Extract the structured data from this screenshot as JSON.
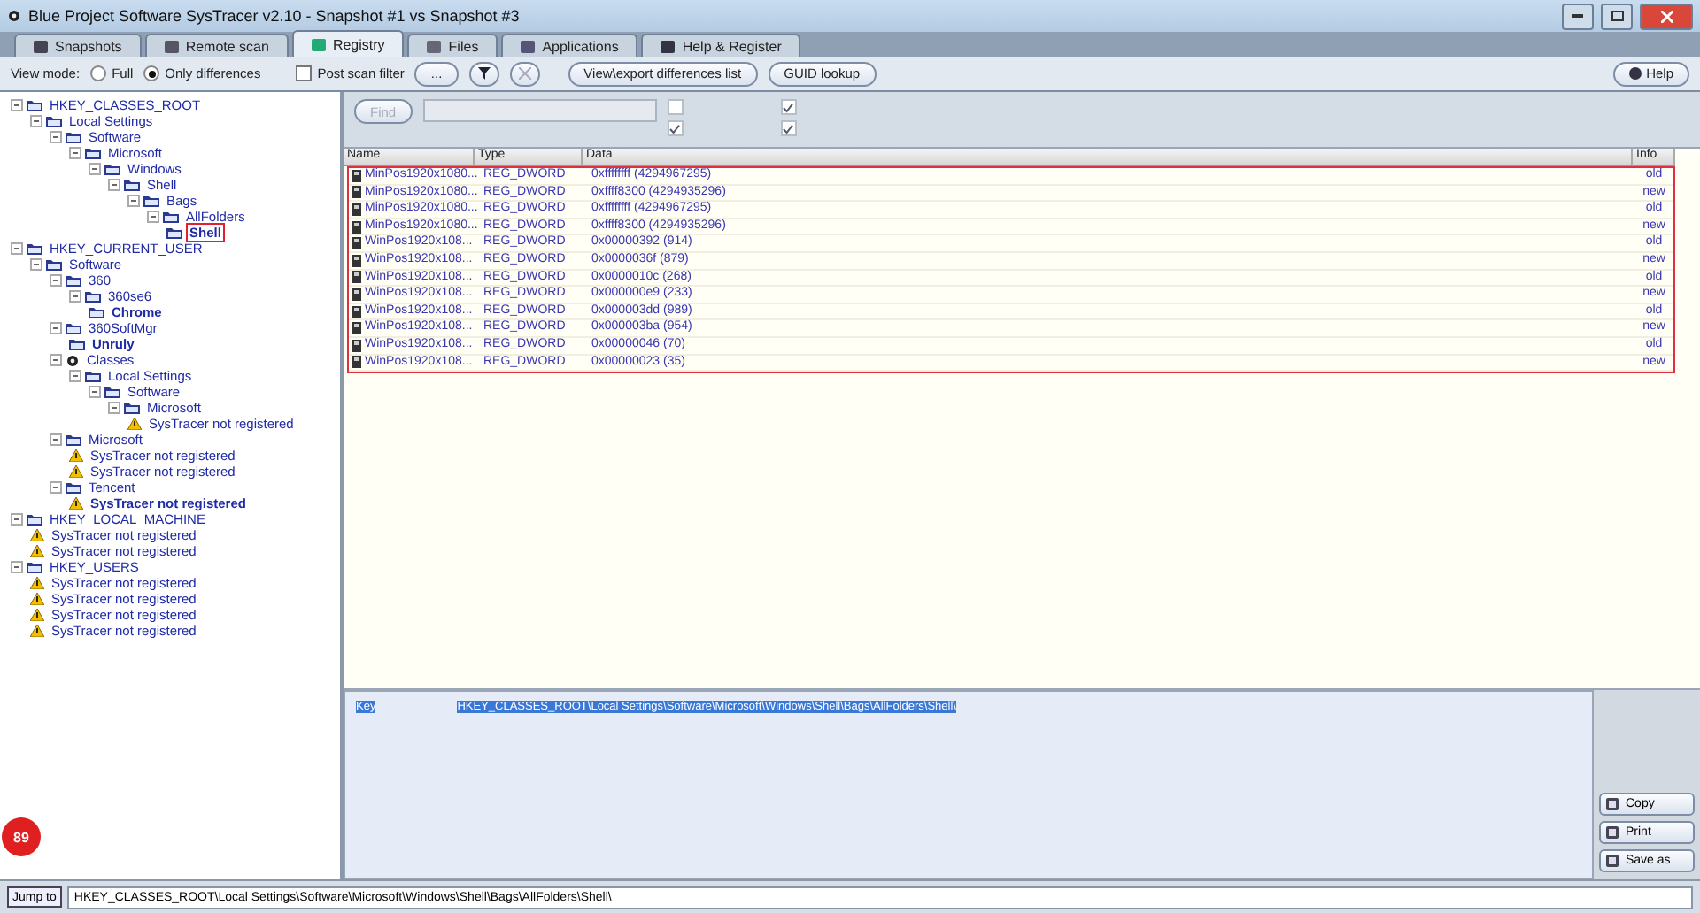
{
  "window": {
    "title": "Blue Project Software SysTracer v2.10 - Snapshot #1 vs Snapshot #3"
  },
  "tabs": [
    {
      "label": "Snapshots",
      "selected": false
    },
    {
      "label": "Remote scan",
      "selected": false
    },
    {
      "label": "Registry",
      "selected": true
    },
    {
      "label": "Files",
      "selected": false
    },
    {
      "label": "Applications",
      "selected": false
    },
    {
      "label": "Help & Register",
      "selected": false
    }
  ],
  "toolbar": {
    "view_mode_label": "View mode:",
    "view_modes": [
      {
        "label": "Full",
        "selected": false
      },
      {
        "label": "Only differences",
        "selected": true
      }
    ],
    "post_scan_filter": {
      "label": "Post scan filter",
      "checked": false
    },
    "more_button": "...",
    "filter_disabled": false,
    "clear_disabled": true,
    "export_button": "View\\export differences list",
    "guid_button": "GUID lookup",
    "help_button": "Help"
  },
  "tree": [
    {
      "label": "HKEY_CLASSES_ROOT",
      "kind": "key",
      "bold": false,
      "selected": false,
      "children": [
        {
          "label": "Local Settings",
          "kind": "key",
          "bold": false,
          "selected": false,
          "children": [
            {
              "label": "Software",
              "kind": "key",
              "bold": false,
              "selected": false,
              "children": [
                {
                  "label": "Microsoft",
                  "kind": "key",
                  "bold": false,
                  "selected": false,
                  "children": [
                    {
                      "label": "Windows",
                      "kind": "key",
                      "bold": false,
                      "selected": false,
                      "children": [
                        {
                          "label": "Shell",
                          "kind": "key",
                          "bold": false,
                          "selected": false,
                          "children": [
                            {
                              "label": "Bags",
                              "kind": "key",
                              "bold": false,
                              "selected": false,
                              "children": [
                                {
                                  "label": "AllFolders",
                                  "kind": "key",
                                  "bold": false,
                                  "selected": false,
                                  "children": [
                                    {
                                      "label": "Shell",
                                      "kind": "key",
                                      "bold": true,
                                      "selected": true
                                    }
                                  ]
                                }
                              ]
                            }
                          ]
                        }
                      ]
                    }
                  ]
                }
              ]
            }
          ]
        }
      ]
    },
    {
      "label": "HKEY_CURRENT_USER",
      "kind": "key",
      "bold": false,
      "selected": false,
      "children": [
        {
          "label": "Software",
          "kind": "key",
          "bold": false,
          "selected": false,
          "children": [
            {
              "label": "360",
              "kind": "key",
              "bold": false,
              "selected": false,
              "children": [
                {
                  "label": "360se6",
                  "kind": "key",
                  "bold": false,
                  "selected": false,
                  "children": [
                    {
                      "label": "Chrome",
                      "kind": "key",
                      "bold": true,
                      "selected": false
                    }
                  ]
                }
              ]
            },
            {
              "label": "360SoftMgr",
              "kind": "key",
              "bold": false,
              "selected": false,
              "children": [
                {
                  "label": "Unruly",
                  "kind": "key",
                  "bold": true,
                  "selected": false
                }
              ]
            },
            {
              "label": "Classes",
              "kind": "classes",
              "bold": false,
              "selected": false,
              "children": [
                {
                  "label": "Local Settings",
                  "kind": "key",
                  "bold": false,
                  "selected": false,
                  "children": [
                    {
                      "label": "Software",
                      "kind": "key",
                      "bold": false,
                      "selected": false,
                      "children": [
                        {
                          "label": "Microsoft",
                          "kind": "key",
                          "bold": false,
                          "selected": false,
                          "children": [
                            {
                              "label": "SysTracer not registered",
                              "kind": "warning",
                              "bold": false,
                              "selected": false
                            }
                          ]
                        }
                      ]
                    }
                  ]
                }
              ]
            },
            {
              "label": "Microsoft",
              "kind": "key",
              "bold": false,
              "selected": false,
              "children": [
                {
                  "label": "SysTracer not registered",
                  "kind": "warning",
                  "bold": false,
                  "selected": false
                },
                {
                  "label": "SysTracer not registered",
                  "kind": "warning",
                  "bold": false,
                  "selected": false
                }
              ]
            },
            {
              "label": "Tencent",
              "kind": "key",
              "bold": false,
              "selected": false,
              "children": [
                {
                  "label": "SysTracer not registered",
                  "kind": "warning",
                  "bold": true,
                  "selected": false
                }
              ]
            }
          ]
        }
      ]
    },
    {
      "label": "HKEY_LOCAL_MACHINE",
      "kind": "key",
      "bold": false,
      "selected": false,
      "children": [
        {
          "label": "SysTracer not registered",
          "kind": "warning",
          "bold": false,
          "selected": false
        },
        {
          "label": "SysTracer not registered",
          "kind": "warning",
          "bold": false,
          "selected": false
        }
      ]
    },
    {
      "label": "HKEY_USERS",
      "kind": "key",
      "bold": false,
      "selected": false,
      "children": [
        {
          "label": "SysTracer not registered",
          "kind": "warning",
          "bold": false,
          "selected": false
        },
        {
          "label": "SysTracer not registered",
          "kind": "warning",
          "bold": false,
          "selected": false
        },
        {
          "label": "SysTracer not registered",
          "kind": "warning",
          "bold": false,
          "selected": false
        },
        {
          "label": "SysTracer not registered",
          "kind": "warning",
          "bold": false,
          "selected": false
        }
      ]
    }
  ],
  "find": {
    "button": "Find",
    "disabled": true,
    "options": [
      {
        "checked": false
      },
      {
        "checked": true
      },
      {
        "checked": true
      },
      {
        "checked": true
      }
    ]
  },
  "table": {
    "columns": [
      "Name",
      "Type",
      "Data",
      "Info"
    ],
    "rows": [
      [
        "MinPos1920x1080...",
        "REG_DWORD",
        "0xffffffff (4294967295)",
        "old"
      ],
      [
        "MinPos1920x1080...",
        "REG_DWORD",
        "0xffff8300 (4294935296)",
        "new"
      ],
      [
        "MinPos1920x1080...",
        "REG_DWORD",
        "0xffffffff (4294967295)",
        "old"
      ],
      [
        "MinPos1920x1080...",
        "REG_DWORD",
        "0xffff8300 (4294935296)",
        "new"
      ],
      [
        "WinPos1920x108...",
        "REG_DWORD",
        "0x00000392 (914)",
        "old"
      ],
      [
        "WinPos1920x108...",
        "REG_DWORD",
        "0x0000036f (879)",
        "new"
      ],
      [
        "WinPos1920x108...",
        "REG_DWORD",
        "0x0000010c (268)",
        "old"
      ],
      [
        "WinPos1920x108...",
        "REG_DWORD",
        "0x000000e9 (233)",
        "new"
      ],
      [
        "WinPos1920x108...",
        "REG_DWORD",
        "0x000003dd (989)",
        "old"
      ],
      [
        "WinPos1920x108...",
        "REG_DWORD",
        "0x000003ba (954)",
        "new"
      ],
      [
        "WinPos1920x108...",
        "REG_DWORD",
        "0x00000046 (70)",
        "old"
      ],
      [
        "WinPos1920x108...",
        "REG_DWORD",
        "0x00000023 (35)",
        "new"
      ]
    ]
  },
  "details": {
    "key_label": "Key",
    "key_value": "HKEY_CLASSES_ROOT\\Local Settings\\Software\\Microsoft\\Windows\\Shell\\Bags\\AllFolders\\Shell\\",
    "buttons": [
      "Copy",
      "Print",
      "Save as"
    ]
  },
  "jump": {
    "button": "Jump to",
    "value": "HKEY_CLASSES_ROOT\\Local Settings\\Software\\Microsoft\\Windows\\Shell\\Bags\\AllFolders\\Shell\\"
  },
  "widget": {
    "badge": "89"
  }
}
